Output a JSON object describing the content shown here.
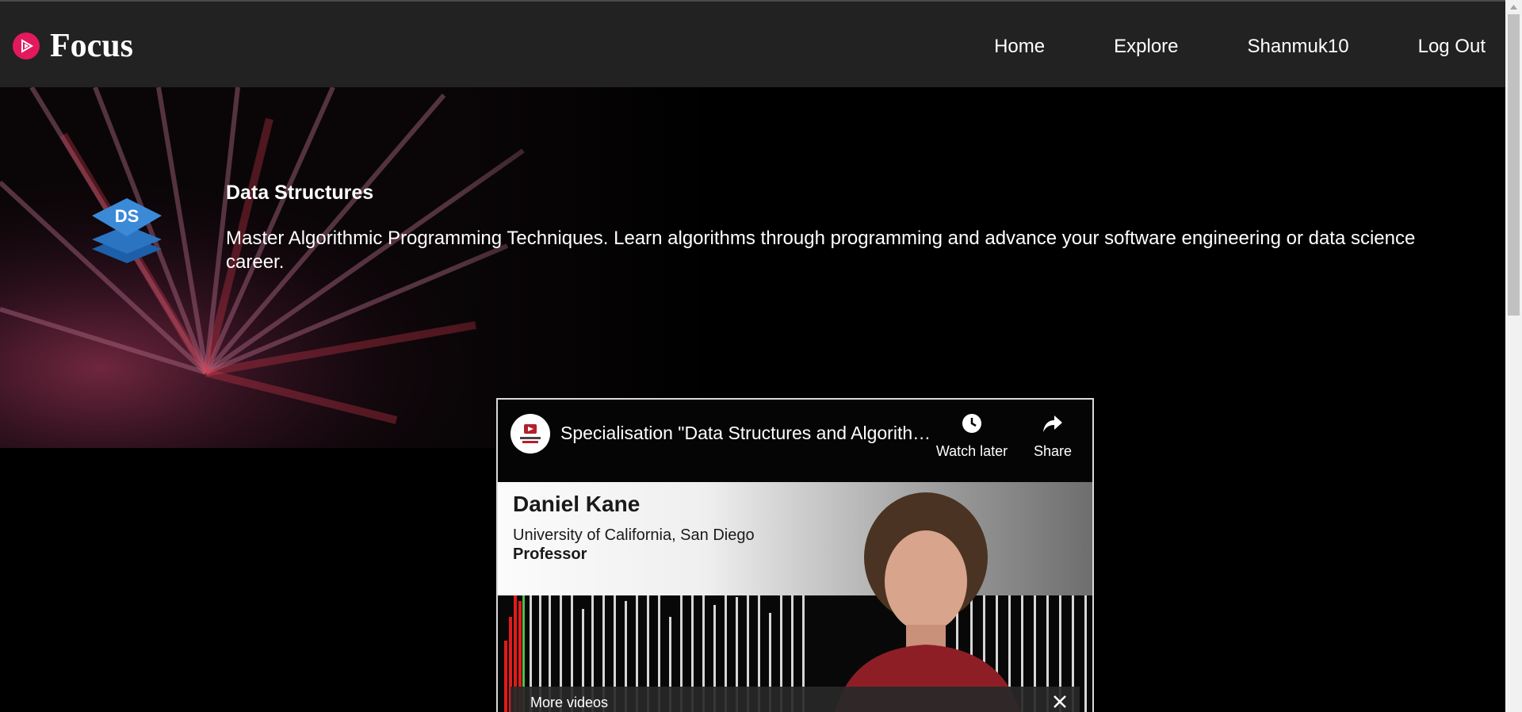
{
  "brand": {
    "name": "Focus",
    "logo_icon": "play-circle-icon",
    "accent": "#e3195e"
  },
  "nav": {
    "links": [
      "Home",
      "Explore",
      "Shanmuk10",
      "Log Out"
    ]
  },
  "course": {
    "logo_text": "DS",
    "title": "Data Structures",
    "description": "Master Algorithmic Programming Techniques. Learn algorithms through programming and advance your software engineering or data science career."
  },
  "video": {
    "title": "Specialisation \"Data Structures and Algorithms\"",
    "watch_later_label": "Watch later",
    "share_label": "Share",
    "presenter_name": "Daniel Kane",
    "presenter_university": "University of California, San Diego",
    "presenter_role": "Professor",
    "more_videos_label": "More videos"
  },
  "colors": {
    "navbar_bg": "#222222",
    "page_bg": "#000000"
  }
}
